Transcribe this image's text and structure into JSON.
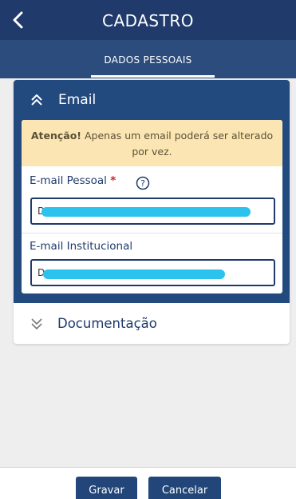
{
  "header": {
    "title": "CADASTRO",
    "back_icon": "chevron-left-icon"
  },
  "subheader": {
    "tab_label": "DADOS PESSOAIS"
  },
  "email_section": {
    "title": "Email",
    "expanded": true,
    "icon": "double-chevron-up-icon",
    "warning": {
      "strong": "Atenção!",
      "text": " Apenas um email poderá ser alterado por vez."
    },
    "personal_email": {
      "label": "E-mail Pessoal",
      "required_mark": "*",
      "help_icon": "help-circle-icon",
      "value_visible": "D"
    },
    "institutional_email": {
      "label": "E-mail Institucional",
      "value_visible": "D"
    }
  },
  "documentation_section": {
    "title": "Documentação",
    "expanded": false,
    "icon": "double-chevron-down-icon"
  },
  "actions": {
    "save_label": "Gravar",
    "cancel_label": "Cancelar"
  },
  "colors": {
    "primary": "#1f3a6b",
    "subheader": "#2b4c7c",
    "warning_bg": "#fbe6b3",
    "required": "#c0262a"
  }
}
